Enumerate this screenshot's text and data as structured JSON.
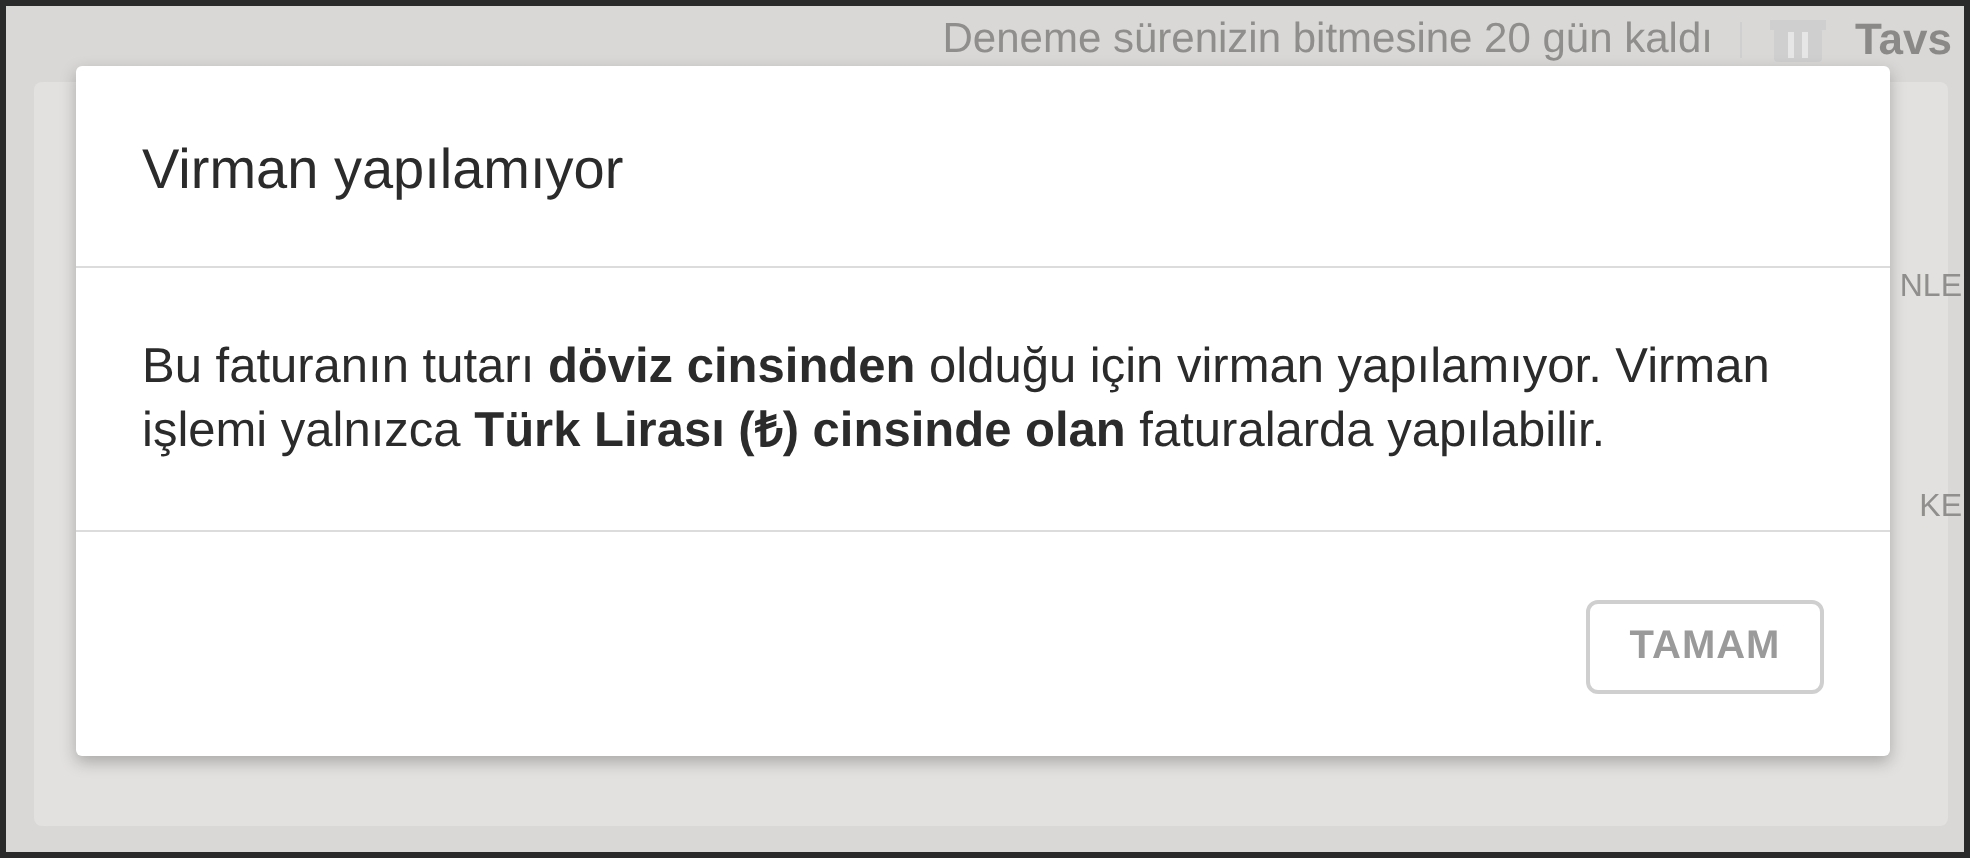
{
  "background": {
    "notice": "Deneme sürenizin bitmesine 20 gün kaldı",
    "top_link": "Tavs",
    "column_fragments": [
      "NLE",
      "KE"
    ]
  },
  "dialog": {
    "title": "Virman yapılamıyor",
    "message": "Bu faturanın tutarı **döviz cinsinden** olduğu için virman yapılamıyor. Virman işlemi yalnızca **Türk Lirası (₺) cinsinde olan** faturalarda yapılabilir.",
    "buttons": [
      {
        "label": "TAMAM"
      }
    ]
  }
}
